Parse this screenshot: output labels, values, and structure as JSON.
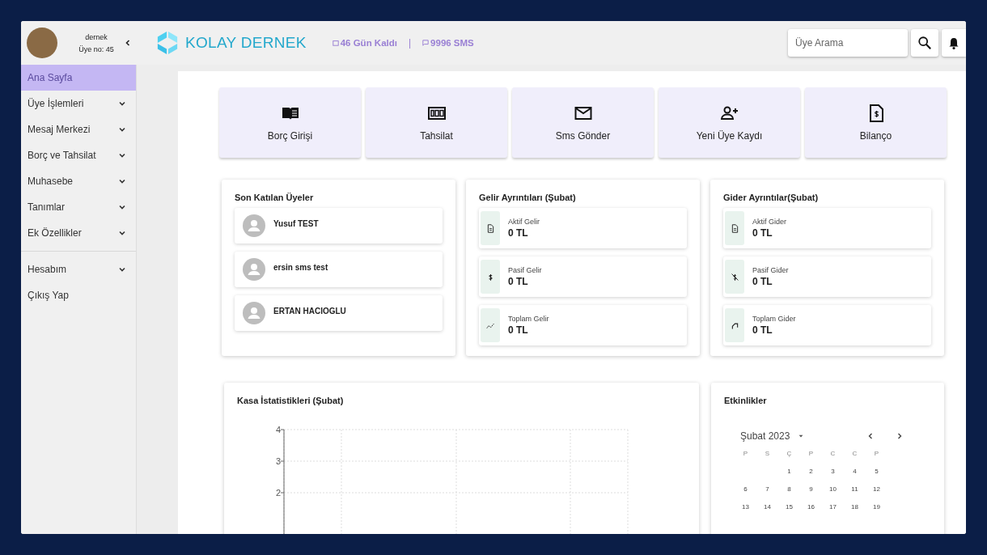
{
  "header": {
    "user_name": "dernek",
    "member_no": "Üye no: 45",
    "logo_text": "KOLAY DERNEK",
    "days_left": "46 Gün Kaldı",
    "separator": "|",
    "sms_count": "9996 SMS",
    "search": {
      "placeholder": "Üye Arama"
    }
  },
  "sidebar": {
    "groups": [
      [
        {
          "label": "Ana Sayfa",
          "selected": true,
          "expandable": false
        },
        {
          "label": "Üye İşlemleri",
          "selected": false,
          "expandable": true
        },
        {
          "label": "Mesaj Merkezi",
          "selected": false,
          "expandable": true
        },
        {
          "label": "Borç ve Tahsilat",
          "selected": false,
          "expandable": true
        },
        {
          "label": "Muhasebe",
          "selected": false,
          "expandable": true
        },
        {
          "label": "Tanımlar",
          "selected": false,
          "expandable": true
        },
        {
          "label": "Ek Özellikler",
          "selected": false,
          "expandable": true
        }
      ],
      [
        {
          "label": "Hesabım",
          "selected": false,
          "expandable": true
        },
        {
          "label": "Çıkış Yap",
          "selected": false,
          "expandable": false
        }
      ]
    ]
  },
  "shortcuts": [
    {
      "kind": "book",
      "label": "Borç Girişi"
    },
    {
      "kind": "counter",
      "label": "Tahsilat"
    },
    {
      "kind": "mail",
      "label": "Sms Gönder"
    },
    {
      "kind": "add-user",
      "label": "Yeni Üye Kaydı"
    },
    {
      "kind": "invoice",
      "label": "Bilanço"
    }
  ],
  "recent_members": {
    "title": "Son Katılan Üyeler",
    "items": [
      {
        "name": "Yusuf TEST"
      },
      {
        "name": "ersin sms test"
      },
      {
        "name": "ERTAN HACIOGLU"
      }
    ]
  },
  "income": {
    "title": "Gelir Ayrıntıları (Şubat)",
    "items": [
      {
        "kind": "doc",
        "label": "Aktif Gelir",
        "amount": "0 TL"
      },
      {
        "kind": "dollar",
        "label": "Pasif Gelir",
        "amount": "0 TL"
      },
      {
        "kind": "trend",
        "label": "Toplam Gelir",
        "amount": "0 TL"
      }
    ]
  },
  "expense": {
    "title": "Gider Ayrıntılar(Şubat)",
    "items": [
      {
        "kind": "doc",
        "label": "Aktif Gider",
        "amount": "0 TL"
      },
      {
        "kind": "no-dollar",
        "label": "Pasif Gider",
        "amount": "0 TL"
      },
      {
        "kind": "trend-up",
        "label": "Toplam Gider",
        "amount": "0 TL"
      }
    ]
  },
  "cash_stats": {
    "title": "Kasa İstatistikleri (Şubat)",
    "y_axis_labels": [
      "4",
      "3",
      "2"
    ]
  },
  "events": {
    "title": "Etkinlikler",
    "month": "Şubat 2023",
    "weekdays": [
      "P",
      "S",
      "Ç",
      "P",
      "C",
      "C",
      "P"
    ],
    "weeks": [
      [
        "1",
        "2",
        "3",
        "4",
        "5"
      ],
      [
        "6",
        "7",
        "8",
        "9",
        "10",
        "11",
        "12"
      ],
      [
        "13",
        "14",
        "15",
        "16",
        "17",
        "18",
        "19"
      ]
    ]
  }
}
